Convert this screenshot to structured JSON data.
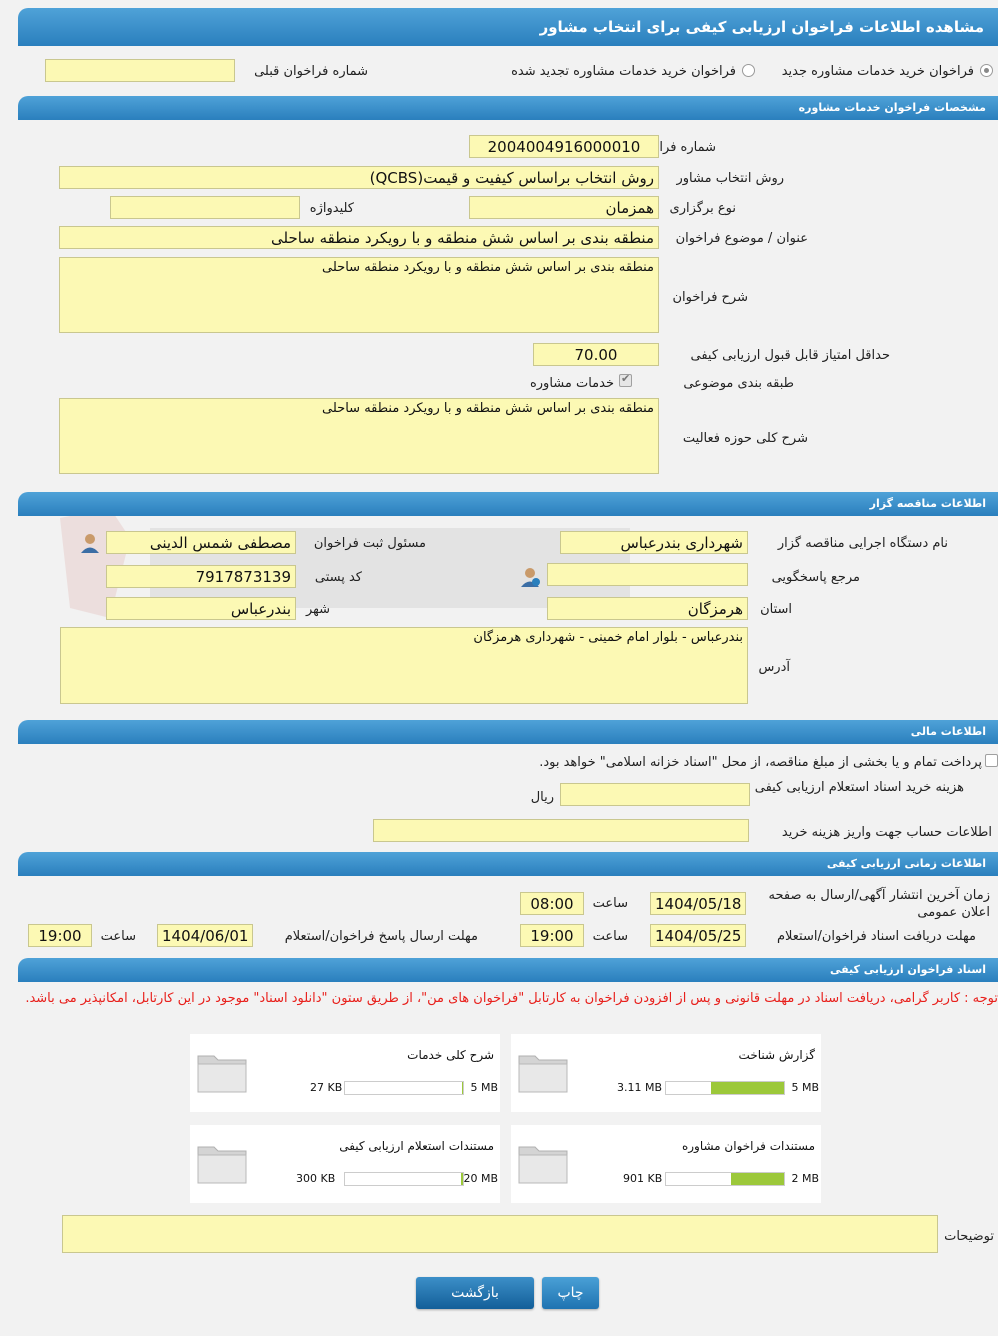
{
  "page": {
    "title": "مشاهده اطلاعات فراخوان ارزیابی کیفی برای انتخاب مشاور",
    "radio_new": "فراخوان خرید خدمات مشاوره جدید",
    "radio_renewed": "فراخوان خرید خدمات مشاوره تجدید شده",
    "prev_call_label": "شماره فراخوان قبلی",
    "prev_call_value": ""
  },
  "consultancy": {
    "header": "مشخصات فراخوان خدمات مشاوره",
    "call_number_label": "شماره فراخوان",
    "call_number": "2004004916000010",
    "method_label": "روش انتخاب مشاور",
    "method": "روش انتخاب براساس کیفیت و قیمت(QCBS)",
    "hold_type_label": "نوع برگزاری",
    "hold_type": "همزمان",
    "keyword_label": "کلیدواژه",
    "keyword": "",
    "subject_label": "عنوان / موضوع فراخوان",
    "subject": "منطقه بندی بر اساس شش منطقه و با رویکرد منطقه ساحلی",
    "description_label": "شرح فراخوان",
    "description": "منطقه بندی بر اساس شش منطقه و با رویکرد منطقه ساحلی",
    "min_score_label": "حداقل امتیاز قابل قبول ارزیابی کیفی",
    "min_score": "70.00",
    "category_label": "طبقه بندی موضوعی",
    "category_option": "خدمات مشاوره",
    "scope_label": "شرح کلی حوزه فعالیت",
    "scope": "منطقه بندی بر اساس شش منطقه و با رویکرد منطقه ساحلی"
  },
  "tenderer": {
    "header": "اطلاعات مناقصه گزار",
    "org_label": "نام دستگاه اجرایی مناقصه گزار",
    "org": "شهرداری بندرعباس",
    "registrar_label": "مسئول ثبت فراخوان",
    "registrar": "مصطفی شمس الدینی",
    "responder_label": "مرجع پاسخگویی",
    "responder": "",
    "postal_label": "کد پستی",
    "postal": "7917873139",
    "province_label": "استان",
    "province": "هرمزگان",
    "city_label": "شهر",
    "city": "بندرعباس",
    "address_label": "آدرس",
    "address": "بندرعباس - بلوار امام خمینی - شهرداری هرمزگان"
  },
  "financial": {
    "header": "اطلاعات مالی",
    "treasury_note": "پرداخت تمام و یا بخشی از مبلغ مناقصه، از محل \"اسناد خزانه اسلامی\" خواهد بود.",
    "fee_label": "هزینه خرید اسناد استعلام ارزیابی کیفی",
    "fee_value": "",
    "fee_unit": "ریال",
    "account_label": "اطلاعات حساب جهت واریز هزینه خرید",
    "account_value": ""
  },
  "timing": {
    "header": "اطلاعات زمانی ارزیابی کیفی",
    "publish_label": "زمان آخرین انتشار آگهی/ارسال به صفحه اعلان عمومی",
    "publish_date": "1404/05/18",
    "publish_time": "08:00",
    "receive_label": "مهلت دریافت اسناد فراخوان/استعلام",
    "receive_date": "1404/05/25",
    "receive_time": "19:00",
    "submit_label": "مهلت ارسال پاسخ فراخوان/استعلام",
    "submit_date": "1404/06/01",
    "submit_time": "19:00",
    "time_label": "ساعت"
  },
  "documents": {
    "header": "اسناد فراخوان ارزیابی کیفی",
    "note": "توجه : کاربر گرامی، دریافت اسناد در مهلت قانونی و پس از افزودن فراخوان به کارتابل \"فراخوان های من\"، از طریق ستون \"دانلود اسناد\" موجود در این کارتابل، امکانپذیر می باشد.",
    "files": [
      {
        "name": "گزارش شناخت",
        "size": "3.11 MB",
        "max": "5 MB",
        "fraction": 0.62
      },
      {
        "name": "شرح کلی خدمات",
        "size": "27 KB",
        "max": "5 MB",
        "fraction": 0.01
      },
      {
        "name": "مستندات فراخوان مشاوره",
        "size": "901 KB",
        "max": "2 MB",
        "fraction": 0.45
      },
      {
        "name": "مستندات استعلام ارزیابی کیفی",
        "size": "300 KB",
        "max": "20 MB",
        "fraction": 0.02
      }
    ],
    "remarks_label": "توضیحات",
    "remarks": ""
  },
  "buttons": {
    "back": "بازگشت",
    "print": "چاپ"
  },
  "colors": {
    "header_blue": "#2a7fbd",
    "field_yellow": "#fcf9b4",
    "note_red": "#e8201c",
    "progress_green": "#9cc83a"
  }
}
